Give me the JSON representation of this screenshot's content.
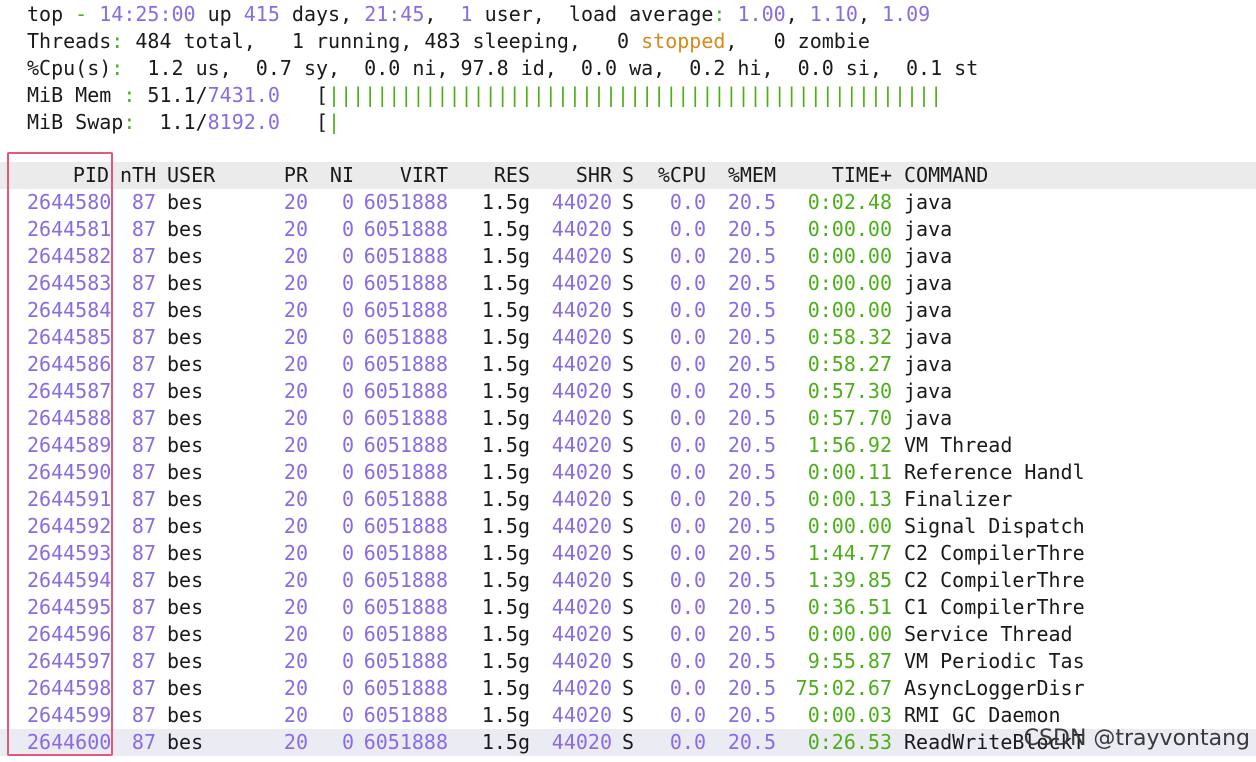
{
  "summary": {
    "l1": [
      {
        "t": "top ",
        "c": ""
      },
      {
        "t": "-",
        "c": "hl-green"
      },
      {
        "t": " ",
        "c": ""
      },
      {
        "t": "14:25:00",
        "c": "hl-purple"
      },
      {
        "t": " up ",
        "c": ""
      },
      {
        "t": "415",
        "c": "hl-purple"
      },
      {
        "t": " days, ",
        "c": ""
      },
      {
        "t": "21:45",
        "c": "hl-purple"
      },
      {
        "t": ",  ",
        "c": ""
      },
      {
        "t": "1",
        "c": "hl-purple"
      },
      {
        "t": " user,  load average",
        "c": ""
      },
      {
        "t": ":",
        "c": "hl-green"
      },
      {
        "t": " ",
        "c": ""
      },
      {
        "t": "1.00",
        "c": "hl-purple"
      },
      {
        "t": ", ",
        "c": ""
      },
      {
        "t": "1.10",
        "c": "hl-purple"
      },
      {
        "t": ", ",
        "c": ""
      },
      {
        "t": "1.09",
        "c": "hl-purple"
      }
    ],
    "l2": [
      {
        "t": "Threads",
        "c": ""
      },
      {
        "t": ":",
        "c": "hl-green"
      },
      {
        "t": " 484 total,   1 running, 483 sleeping,   0 ",
        "c": ""
      },
      {
        "t": "stopped",
        "c": "hl-orange"
      },
      {
        "t": ",   0 zombie",
        "c": ""
      }
    ],
    "l3": [
      {
        "t": "%Cpu(s)",
        "c": ""
      },
      {
        "t": ":",
        "c": "hl-green"
      },
      {
        "t": "  1.2 us,  0.7 sy,  0.0 ni, 97.8 id,  0.0 wa,  0.2 hi,  0.0 si,  0.1 st",
        "c": ""
      }
    ],
    "l4": [
      {
        "t": "MiB Mem ",
        "c": ""
      },
      {
        "t": ":",
        "c": "hl-green"
      },
      {
        "t": " 51.1/",
        "c": ""
      },
      {
        "t": "7431.0",
        "c": "hl-purple"
      },
      {
        "t": "   [",
        "c": ""
      },
      {
        "t": "|||||||||||||||||||||||||||||||||||||||||||||||||||",
        "c": "hl-green"
      }
    ],
    "l5": [
      {
        "t": "MiB Swap",
        "c": ""
      },
      {
        "t": ":",
        "c": "hl-green"
      },
      {
        "t": "  1.1/",
        "c": ""
      },
      {
        "t": "8192.0",
        "c": "hl-purple"
      },
      {
        "t": "   [",
        "c": ""
      },
      {
        "t": "|",
        "c": "hl-green"
      }
    ]
  },
  "columns": {
    "pid": "PID",
    "nth": "nTH",
    "user": "USER",
    "pr": "PR",
    "ni": "NI",
    "virt": "VIRT",
    "res": "RES",
    "shr": "SHR",
    "s": "S",
    "cpu": "%CPU",
    "mem": "%MEM",
    "time": "TIME+",
    "cmd": "COMMAND"
  },
  "rows": [
    {
      "pid": "2644580",
      "nth": "87",
      "user": "bes",
      "pr": "20",
      "ni": "0",
      "virt": "6051888",
      "res": "1.5g",
      "shr": "44020",
      "s": "S",
      "cpu": "0.0",
      "mem": "20.5",
      "time": "0:02.48",
      "cmd": "java"
    },
    {
      "pid": "2644581",
      "nth": "87",
      "user": "bes",
      "pr": "20",
      "ni": "0",
      "virt": "6051888",
      "res": "1.5g",
      "shr": "44020",
      "s": "S",
      "cpu": "0.0",
      "mem": "20.5",
      "time": "0:00.00",
      "cmd": "java"
    },
    {
      "pid": "2644582",
      "nth": "87",
      "user": "bes",
      "pr": "20",
      "ni": "0",
      "virt": "6051888",
      "res": "1.5g",
      "shr": "44020",
      "s": "S",
      "cpu": "0.0",
      "mem": "20.5",
      "time": "0:00.00",
      "cmd": "java"
    },
    {
      "pid": "2644583",
      "nth": "87",
      "user": "bes",
      "pr": "20",
      "ni": "0",
      "virt": "6051888",
      "res": "1.5g",
      "shr": "44020",
      "s": "S",
      "cpu": "0.0",
      "mem": "20.5",
      "time": "0:00.00",
      "cmd": "java"
    },
    {
      "pid": "2644584",
      "nth": "87",
      "user": "bes",
      "pr": "20",
      "ni": "0",
      "virt": "6051888",
      "res": "1.5g",
      "shr": "44020",
      "s": "S",
      "cpu": "0.0",
      "mem": "20.5",
      "time": "0:00.00",
      "cmd": "java"
    },
    {
      "pid": "2644585",
      "nth": "87",
      "user": "bes",
      "pr": "20",
      "ni": "0",
      "virt": "6051888",
      "res": "1.5g",
      "shr": "44020",
      "s": "S",
      "cpu": "0.0",
      "mem": "20.5",
      "time": "0:58.32",
      "cmd": "java"
    },
    {
      "pid": "2644586",
      "nth": "87",
      "user": "bes",
      "pr": "20",
      "ni": "0",
      "virt": "6051888",
      "res": "1.5g",
      "shr": "44020",
      "s": "S",
      "cpu": "0.0",
      "mem": "20.5",
      "time": "0:58.27",
      "cmd": "java"
    },
    {
      "pid": "2644587",
      "nth": "87",
      "user": "bes",
      "pr": "20",
      "ni": "0",
      "virt": "6051888",
      "res": "1.5g",
      "shr": "44020",
      "s": "S",
      "cpu": "0.0",
      "mem": "20.5",
      "time": "0:57.30",
      "cmd": "java"
    },
    {
      "pid": "2644588",
      "nth": "87",
      "user": "bes",
      "pr": "20",
      "ni": "0",
      "virt": "6051888",
      "res": "1.5g",
      "shr": "44020",
      "s": "S",
      "cpu": "0.0",
      "mem": "20.5",
      "time": "0:57.70",
      "cmd": "java"
    },
    {
      "pid": "2644589",
      "nth": "87",
      "user": "bes",
      "pr": "20",
      "ni": "0",
      "virt": "6051888",
      "res": "1.5g",
      "shr": "44020",
      "s": "S",
      "cpu": "0.0",
      "mem": "20.5",
      "time": "1:56.92",
      "cmd": "VM Thread"
    },
    {
      "pid": "2644590",
      "nth": "87",
      "user": "bes",
      "pr": "20",
      "ni": "0",
      "virt": "6051888",
      "res": "1.5g",
      "shr": "44020",
      "s": "S",
      "cpu": "0.0",
      "mem": "20.5",
      "time": "0:00.11",
      "cmd": "Reference Handl"
    },
    {
      "pid": "2644591",
      "nth": "87",
      "user": "bes",
      "pr": "20",
      "ni": "0",
      "virt": "6051888",
      "res": "1.5g",
      "shr": "44020",
      "s": "S",
      "cpu": "0.0",
      "mem": "20.5",
      "time": "0:00.13",
      "cmd": "Finalizer"
    },
    {
      "pid": "2644592",
      "nth": "87",
      "user": "bes",
      "pr": "20",
      "ni": "0",
      "virt": "6051888",
      "res": "1.5g",
      "shr": "44020",
      "s": "S",
      "cpu": "0.0",
      "mem": "20.5",
      "time": "0:00.00",
      "cmd": "Signal Dispatch"
    },
    {
      "pid": "2644593",
      "nth": "87",
      "user": "bes",
      "pr": "20",
      "ni": "0",
      "virt": "6051888",
      "res": "1.5g",
      "shr": "44020",
      "s": "S",
      "cpu": "0.0",
      "mem": "20.5",
      "time": "1:44.77",
      "cmd": "C2 CompilerThre"
    },
    {
      "pid": "2644594",
      "nth": "87",
      "user": "bes",
      "pr": "20",
      "ni": "0",
      "virt": "6051888",
      "res": "1.5g",
      "shr": "44020",
      "s": "S",
      "cpu": "0.0",
      "mem": "20.5",
      "time": "1:39.85",
      "cmd": "C2 CompilerThre"
    },
    {
      "pid": "2644595",
      "nth": "87",
      "user": "bes",
      "pr": "20",
      "ni": "0",
      "virt": "6051888",
      "res": "1.5g",
      "shr": "44020",
      "s": "S",
      "cpu": "0.0",
      "mem": "20.5",
      "time": "0:36.51",
      "cmd": "C1 CompilerThre"
    },
    {
      "pid": "2644596",
      "nth": "87",
      "user": "bes",
      "pr": "20",
      "ni": "0",
      "virt": "6051888",
      "res": "1.5g",
      "shr": "44020",
      "s": "S",
      "cpu": "0.0",
      "mem": "20.5",
      "time": "0:00.00",
      "cmd": "Service Thread"
    },
    {
      "pid": "2644597",
      "nth": "87",
      "user": "bes",
      "pr": "20",
      "ni": "0",
      "virt": "6051888",
      "res": "1.5g",
      "shr": "44020",
      "s": "S",
      "cpu": "0.0",
      "mem": "20.5",
      "time": "9:55.87",
      "cmd": "VM Periodic Tas"
    },
    {
      "pid": "2644598",
      "nth": "87",
      "user": "bes",
      "pr": "20",
      "ni": "0",
      "virt": "6051888",
      "res": "1.5g",
      "shr": "44020",
      "s": "S",
      "cpu": "0.0",
      "mem": "20.5",
      "time": "75:02.67",
      "cmd": "AsyncLoggerDisr"
    },
    {
      "pid": "2644599",
      "nth": "87",
      "user": "bes",
      "pr": "20",
      "ni": "0",
      "virt": "6051888",
      "res": "1.5g",
      "shr": "44020",
      "s": "S",
      "cpu": "0.0",
      "mem": "20.5",
      "time": "0:00.03",
      "cmd": "RMI GC Daemon"
    },
    {
      "pid": "2644600",
      "nth": "87",
      "user": "bes",
      "pr": "20",
      "ni": "0",
      "virt": "6051888",
      "res": "1.5g",
      "shr": "44020",
      "s": "S",
      "cpu": "0.0",
      "mem": "20.5",
      "time": "0:26.53",
      "cmd": "ReadWriteBlockT"
    }
  ],
  "watermark": "CSDN @trayvontang",
  "colors": {
    "accent_green": "#4caf1a",
    "accent_purple": "#8a6be0",
    "accent_orange": "#d58a1a",
    "highlight_box": "#e2577a",
    "header_bg": "#ebebeb"
  }
}
